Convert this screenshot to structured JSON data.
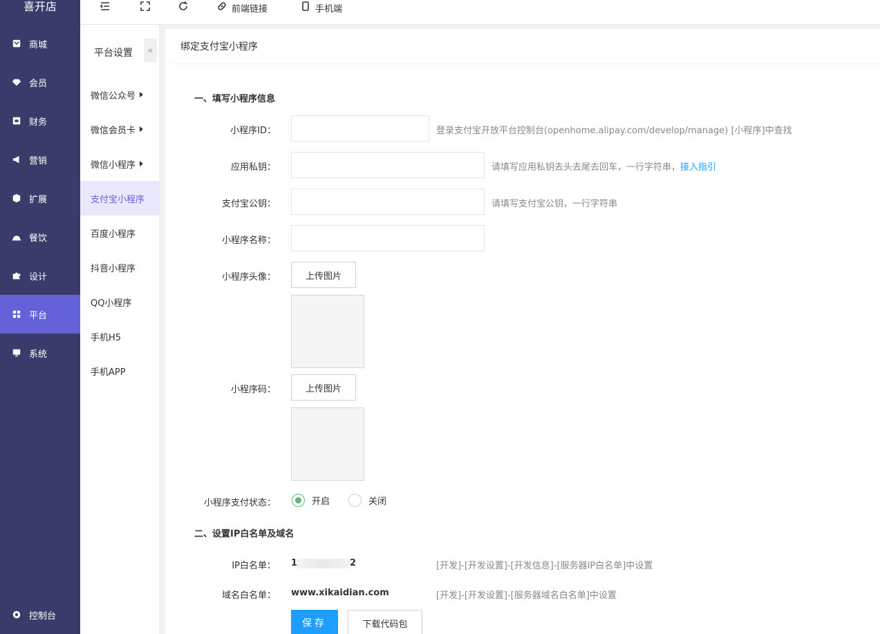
{
  "brand": "喜开店",
  "nav": [
    {
      "label": "商城",
      "icon": "store-icon"
    },
    {
      "label": "会员",
      "icon": "diamond-icon"
    },
    {
      "label": "财务",
      "icon": "finance-icon"
    },
    {
      "label": "营销",
      "icon": "megaphone-icon"
    },
    {
      "label": "扩展",
      "icon": "cube-icon"
    },
    {
      "label": "餐饮",
      "icon": "dish-icon"
    },
    {
      "label": "设计",
      "icon": "puzzle-icon"
    },
    {
      "label": "平台",
      "icon": "grid-icon"
    },
    {
      "label": "系统",
      "icon": "monitor-icon"
    }
  ],
  "nav_active": "平台",
  "control_panel": "控制台",
  "toolbar": {
    "frontend_link": "前端链接",
    "mobile": "手机端"
  },
  "subnav": {
    "title": "平台设置",
    "collapse": "«",
    "items": [
      {
        "label": "微信公众号"
      },
      {
        "label": "微信会员卡"
      },
      {
        "label": "微信小程序"
      },
      {
        "label": "支付宝小程序"
      },
      {
        "label": "百度小程序"
      },
      {
        "label": "抖音小程序"
      },
      {
        "label": "QQ小程序"
      },
      {
        "label": "手机H5"
      },
      {
        "label": "手机APP"
      }
    ]
  },
  "panel": {
    "title": "绑定支付宝小程序",
    "section1": "一、填写小程序信息",
    "section2": "二、设置IP白名单及域名",
    "fields": {
      "app_id_label": "小程序ID：",
      "app_id_hint": "登录支付宝开放平台控制台(openhome.alipay.com/develop/manage) [小程序]中查找",
      "private_key_label": "应用私钥：",
      "private_key_hint": "请填写应用私钥去头去尾去回车，一行字符串，",
      "private_key_link": "接入指引",
      "public_key_label": "支付宝公钥：",
      "public_key_hint": "请填写支付宝公钥，一行字符串",
      "name_label": "小程序名称：",
      "avatar_label": "小程序头像：",
      "qrcode_label": "小程序码：",
      "upload": "上传图片",
      "pay_status_label": "小程序支付状态：",
      "pay_on": "开启",
      "pay_off": "关闭",
      "ip_label": "IP白名单：",
      "ip_value_start": "1",
      "ip_value_end": "2",
      "ip_hint": "[开发]-[开发设置]-[开发信息]-[服务器IP白名单]中设置",
      "domain_label": "域名白名单：",
      "domain_value": "www.xikaidian.com",
      "domain_hint": "[开发]-[开发设置]-[服务器域名白名单]中设置"
    },
    "save": "保存",
    "download": "下载代码包"
  },
  "colors": {
    "nav_bg": "#3a3b6a",
    "nav_active": "#6462d8",
    "primary": "#1e9fff",
    "radio_on": "#5fb878"
  }
}
